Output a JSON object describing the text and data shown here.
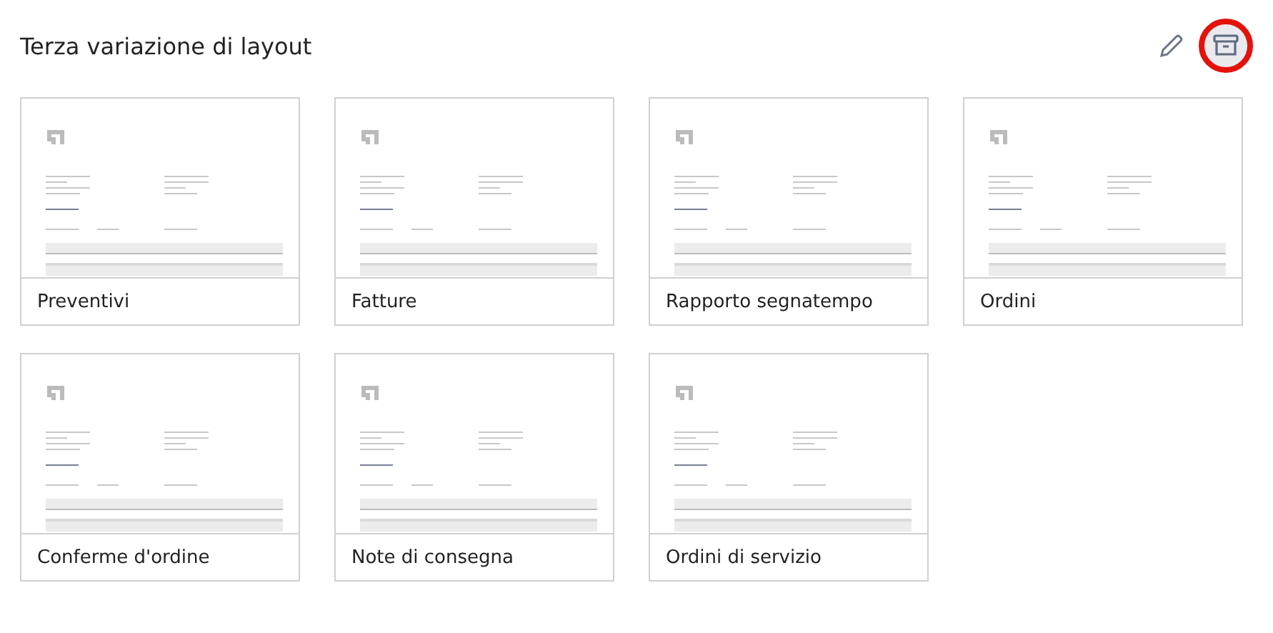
{
  "title": "Terza variazione di layout",
  "actions": [
    {
      "kind": "edit",
      "highlighted": false
    },
    {
      "kind": "archive",
      "highlighted": true
    }
  ],
  "layouts": [
    {
      "label": "Preventivi"
    },
    {
      "label": "Fatture"
    },
    {
      "label": "Rapporto segnatempo"
    },
    {
      "label": "Ordini"
    },
    {
      "label": "Conferme d'ordine"
    },
    {
      "label": "Note di consegna"
    },
    {
      "label": "Ordini di servizio"
    }
  ]
}
